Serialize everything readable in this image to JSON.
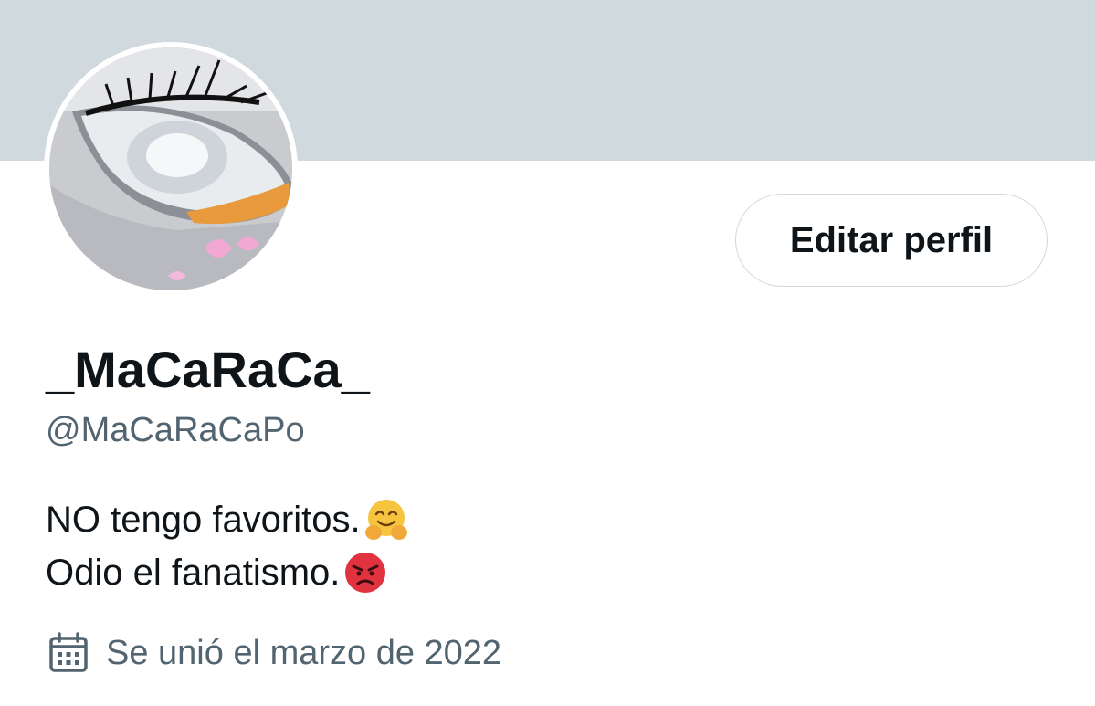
{
  "profile": {
    "display_name": "_MaCaRaCa_",
    "handle": "@MaCaRaCaPo",
    "edit_button_label": "Editar perfil",
    "bio_lines": [
      {
        "text": "NO tengo favoritos.",
        "emoji": "hugging-face-emoji"
      },
      {
        "text": "Odio el fanatismo.",
        "emoji": "angry-face-emoji"
      }
    ],
    "joined_text": "Se unió el marzo de 2022",
    "joined_icon": "calendar-icon",
    "avatar_description": "car-headlight-with-eyelashes"
  },
  "colors": {
    "banner": "#cfd9de",
    "primary_text": "#0f1419",
    "secondary_text": "#536471",
    "button_border": "#cfd9de"
  }
}
